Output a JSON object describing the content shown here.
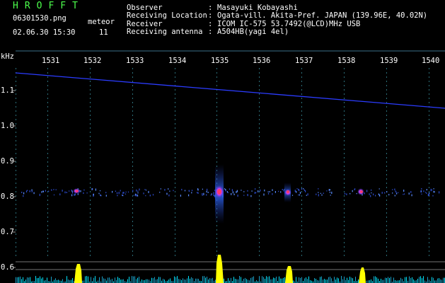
{
  "header": {
    "brand": "HROFFT",
    "filename": "06301530.png",
    "datetime": "02.06.30 15:30",
    "meteor_label": "meteor",
    "meteor_count": "11",
    "info": [
      {
        "label": "Observer",
        "value": "Masayuki Kobayashi"
      },
      {
        "label": "Receiving Location",
        "value": "Ogata-vill. Akita-Pref. JAPAN (139.96E, 40.02N)"
      },
      {
        "label": "Receiver",
        "value": "ICOM IC-575 53.7492(@LCD)MHz USB"
      },
      {
        "label": "Receiving antenna",
        "value": "A504HB(yagi 4el)"
      }
    ],
    "separator": ":"
  },
  "axes": {
    "y_unit": "kHz",
    "x_ticks": [
      "1531",
      "1532",
      "1533",
      "1534",
      "1535",
      "1536",
      "1537",
      "1538",
      "1539",
      "1540"
    ],
    "y_ticks": [
      "1.1",
      "1.0",
      "0.9",
      "0.8",
      "0.7",
      "0.6"
    ]
  },
  "colors": {
    "background": "#000000",
    "brand": "#4cff4c",
    "grid_dots": "#2c6f7a",
    "carrier": "#2b3cff",
    "echo_hot": "#ff3b6b",
    "echo_mid": "#5a8cff",
    "level_bar": "#ffff00",
    "level_noise": "#00e5ff"
  }
}
